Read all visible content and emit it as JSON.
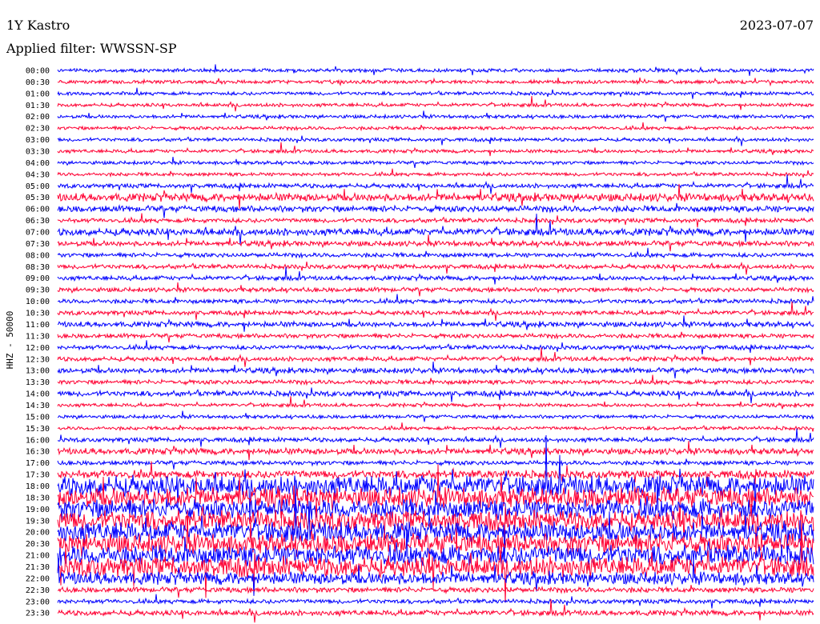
{
  "header": {
    "station": "1Y Kastro",
    "date": "2023-07-07",
    "filter": "Applied filter: WWSSN-SP"
  },
  "chart_data": {
    "type": "line",
    "title": "1Y Kastro",
    "subtitle": "Applied filter: WWSSN-SP",
    "ylabel": "HHZ - 50000",
    "xlabel": "",
    "trace_colors": [
      "#0000ff",
      "#ff0033"
    ],
    "time_labels": [
      "00:00",
      "00:30",
      "01:00",
      "01:30",
      "02:00",
      "02:30",
      "03:00",
      "03:30",
      "04:00",
      "04:30",
      "05:00",
      "05:30",
      "06:00",
      "06:30",
      "07:00",
      "07:30",
      "08:00",
      "08:30",
      "09:00",
      "09:30",
      "10:00",
      "10:30",
      "11:00",
      "11:30",
      "12:00",
      "12:30",
      "13:00",
      "13:30",
      "14:00",
      "14:30",
      "15:00",
      "15:30",
      "16:00",
      "16:30",
      "17:00",
      "17:30",
      "18:00",
      "18:30",
      "19:00",
      "19:30",
      "20:00",
      "20:30",
      "21:00",
      "21:30",
      "22:00",
      "22:30",
      "23:00",
      "23:30"
    ],
    "series": [
      {
        "values": [
          0.1,
          0.1,
          0.1,
          0.1,
          0.1,
          0.1,
          0.1,
          0.1,
          0.1,
          0.1,
          0.15,
          0.35,
          0.25,
          0.15,
          0.3,
          0.2,
          0.15,
          0.15,
          0.15,
          0.15,
          0.15,
          0.15,
          0.2,
          0.15,
          0.15,
          0.15,
          0.2,
          0.15,
          0.2,
          0.1,
          0.1,
          0.1,
          0.15,
          0.25,
          0.15,
          0.35,
          1.0,
          1.0,
          1.0,
          1.0,
          1.0,
          1.0,
          1.0,
          1.0,
          0.6,
          0.2,
          0.15,
          0.2
        ]
      }
    ]
  }
}
